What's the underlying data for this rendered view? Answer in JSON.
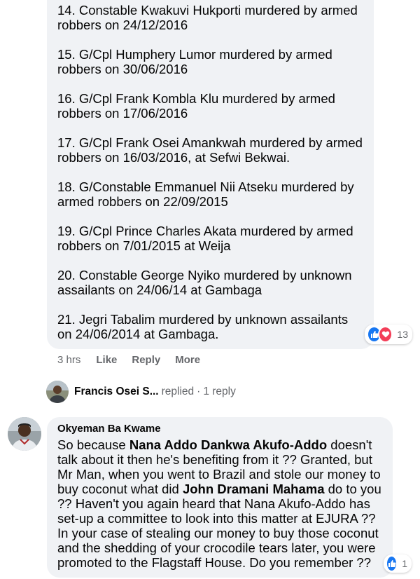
{
  "comment1": {
    "entries": [
      "14. Constable Kwakuvi Hukporti murdered by armed robbers on 24/12/2016",
      "15. G/Cpl Humphery Lumor murdered by armed robbers on 30/06/2016",
      "16. G/Cpl Frank Kombla Klu murdered by armed robbers on 17/06/2016",
      "17. G/Cpl Frank Osei Amankwah murdered by armed robbers on 16/03/2016, at Sefwi Bekwai.",
      "18. G/Constable Emmanuel Nii Atseku murdered by armed robbers on 22/09/2015",
      "19. G/Cpl Prince Charles Akata murdered by armed robbers on 7/01/2015 at Weija",
      "20. Constable George Nyiko murdered by unknown assailants on 24/06/14 at Gambaga",
      "21. Jegri Tabalim murdered by unknown assailants on 24/06/2014 at Gambaga."
    ],
    "reactions": {
      "icons": [
        "like-icon",
        "love-icon"
      ],
      "count": "13"
    },
    "actions": {
      "time": "3 hrs",
      "like": "Like",
      "reply": "Reply",
      "more": "More"
    }
  },
  "reply_summary": {
    "name": "Francis Osei S...",
    "verb": "replied",
    "separator": "·",
    "count": "1 reply"
  },
  "comment2": {
    "author": "Okyeman Ba Kwame",
    "text_parts": {
      "p1": "So because ",
      "m1": "Nana Addo Dankwa Akufo-Addo",
      "p2": " doesn't talk about it then he's benefiting from it ?? Granted, but Mr Man, when you went to Brazil and stole our money to buy coconut what did ",
      "m2": "John Dramani Mahama",
      "p3": " do to you ?? Haven't you again heard that Nana Akufo-Addo has set-up a committee to look into this matter at EJURA ?? In your case of stealing our money to buy those coconut and the shedding of your crocodile tears later, you were promoted to the Flagstaff House. Do you remember ??"
    },
    "reactions": {
      "icons": [
        "like-icon"
      ],
      "count": "1"
    }
  },
  "colors": {
    "bubble": "#f0f2f5",
    "secondary_text": "#65676b",
    "like_blue": "#1877f2",
    "love_red": "#f33e58"
  }
}
